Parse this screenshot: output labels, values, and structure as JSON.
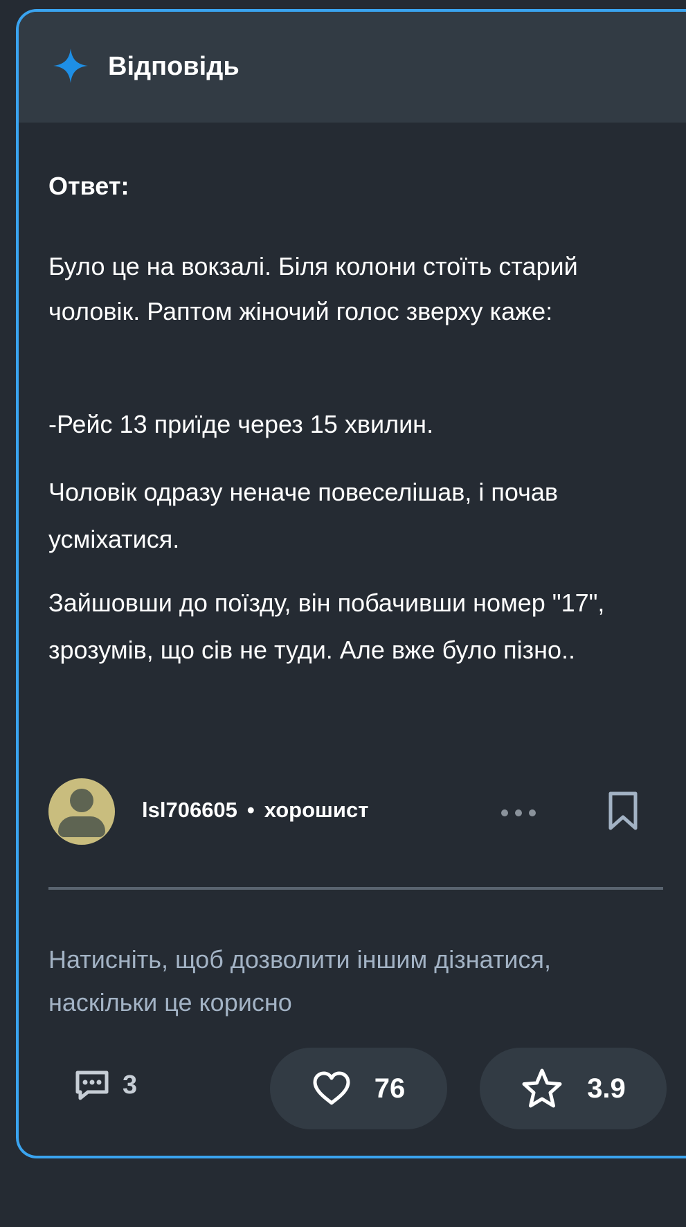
{
  "header": {
    "title": "Відповідь",
    "icon": "sparkle-icon",
    "accent_color": "#1e8fe6"
  },
  "answer": {
    "label": "Ответ:",
    "paragraphs": [
      "Було це на вокзалі. Біля колони стоїть старий чоловік. Раптом жіночий голос зверху каже:",
      "-Рейс 13 приїде через 15 хвилин.",
      "Чоловік одразу неначе повеселішав, і почав усміхатися.",
      "Зайшовши до поїзду, він побачивши номер \"17\", зрозумів, що сів не туди. Але вже було пізно.."
    ]
  },
  "author": {
    "name": "lsl706605",
    "separator": "•",
    "rank": "хорошист",
    "avatar_icon": "user-avatar-icon"
  },
  "actions": {
    "more_icon": "more-dots-icon",
    "bookmark_icon": "bookmark-icon"
  },
  "feedback": {
    "hint": "Натисніть, щоб дозволити іншим дізнатися, наскільки це корисно"
  },
  "stats": {
    "comments": "3",
    "likes": "76",
    "rating": "3.9"
  },
  "colors": {
    "border": "#3aa4f0",
    "background": "#252b33",
    "header_bg": "#323b44",
    "hint_text": "#a3b3c5",
    "avatar_bg": "#c9bd7e"
  }
}
